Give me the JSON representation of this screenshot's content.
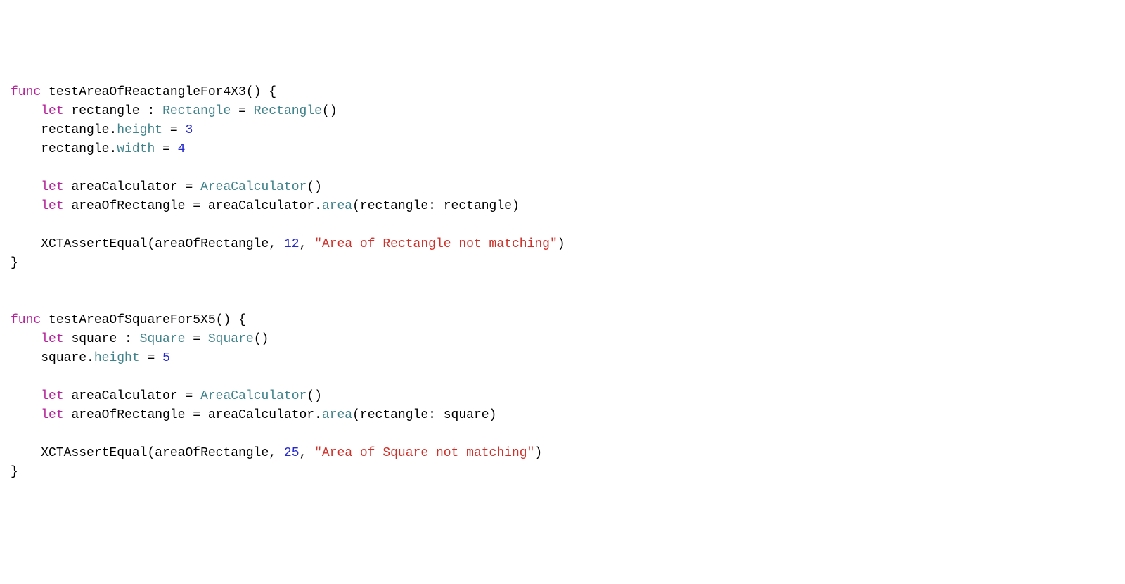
{
  "colors": {
    "keyword": "#b5219b",
    "type": "#3e828b",
    "number": "#2529cf",
    "string": "#cf2f28",
    "plain": "#000000",
    "background": "#ffffff"
  },
  "code": {
    "lines": [
      {
        "indent": 0,
        "tokens": [
          {
            "t": "func ",
            "c": "keyword"
          },
          {
            "t": "testAreaOfReactangleFor4X3() {",
            "c": "plain"
          }
        ]
      },
      {
        "indent": 1,
        "tokens": [
          {
            "t": "let ",
            "c": "keyword"
          },
          {
            "t": "rectangle : ",
            "c": "plain"
          },
          {
            "t": "Rectangle",
            "c": "type"
          },
          {
            "t": " = ",
            "c": "plain"
          },
          {
            "t": "Rectangle",
            "c": "type"
          },
          {
            "t": "()",
            "c": "plain"
          }
        ]
      },
      {
        "indent": 1,
        "tokens": [
          {
            "t": "rectangle.",
            "c": "plain"
          },
          {
            "t": "height",
            "c": "property"
          },
          {
            "t": " = ",
            "c": "plain"
          },
          {
            "t": "3",
            "c": "number"
          }
        ]
      },
      {
        "indent": 1,
        "tokens": [
          {
            "t": "rectangle.",
            "c": "plain"
          },
          {
            "t": "width",
            "c": "property"
          },
          {
            "t": " = ",
            "c": "plain"
          },
          {
            "t": "4",
            "c": "number"
          }
        ]
      },
      {
        "indent": 0,
        "tokens": [
          {
            "t": "",
            "c": "plain"
          }
        ]
      },
      {
        "indent": 1,
        "tokens": [
          {
            "t": "let ",
            "c": "keyword"
          },
          {
            "t": "areaCalculator = ",
            "c": "plain"
          },
          {
            "t": "AreaCalculator",
            "c": "type"
          },
          {
            "t": "()",
            "c": "plain"
          }
        ]
      },
      {
        "indent": 1,
        "tokens": [
          {
            "t": "let ",
            "c": "keyword"
          },
          {
            "t": "areaOfRectangle = areaCalculator.",
            "c": "plain"
          },
          {
            "t": "area",
            "c": "method"
          },
          {
            "t": "(rectangle: rectangle)",
            "c": "plain"
          }
        ]
      },
      {
        "indent": 0,
        "tokens": [
          {
            "t": "",
            "c": "plain"
          }
        ]
      },
      {
        "indent": 1,
        "tokens": [
          {
            "t": "XCTAssertEqual",
            "c": "plain"
          },
          {
            "t": "(areaOfRectangle, ",
            "c": "plain"
          },
          {
            "t": "12",
            "c": "number"
          },
          {
            "t": ", ",
            "c": "plain"
          },
          {
            "t": "\"Area of Rectangle not matching\"",
            "c": "string"
          },
          {
            "t": ")",
            "c": "plain"
          }
        ]
      },
      {
        "indent": 0,
        "tokens": [
          {
            "t": "}",
            "c": "plain"
          }
        ]
      },
      {
        "indent": 0,
        "tokens": [
          {
            "t": "",
            "c": "plain"
          }
        ]
      },
      {
        "indent": 0,
        "tokens": [
          {
            "t": "",
            "c": "plain"
          }
        ]
      },
      {
        "indent": 0,
        "tokens": [
          {
            "t": "func ",
            "c": "keyword"
          },
          {
            "t": "testAreaOfSquareFor5X5() {",
            "c": "plain"
          }
        ]
      },
      {
        "indent": 1,
        "tokens": [
          {
            "t": "let ",
            "c": "keyword"
          },
          {
            "t": "square : ",
            "c": "plain"
          },
          {
            "t": "Square",
            "c": "type"
          },
          {
            "t": " = ",
            "c": "plain"
          },
          {
            "t": "Square",
            "c": "type"
          },
          {
            "t": "()",
            "c": "plain"
          }
        ]
      },
      {
        "indent": 1,
        "tokens": [
          {
            "t": "square.",
            "c": "plain"
          },
          {
            "t": "height",
            "c": "property"
          },
          {
            "t": " = ",
            "c": "plain"
          },
          {
            "t": "5",
            "c": "number"
          }
        ]
      },
      {
        "indent": 0,
        "tokens": [
          {
            "t": "",
            "c": "plain"
          }
        ]
      },
      {
        "indent": 1,
        "tokens": [
          {
            "t": "let ",
            "c": "keyword"
          },
          {
            "t": "areaCalculator = ",
            "c": "plain"
          },
          {
            "t": "AreaCalculator",
            "c": "type"
          },
          {
            "t": "()",
            "c": "plain"
          }
        ]
      },
      {
        "indent": 1,
        "tokens": [
          {
            "t": "let ",
            "c": "keyword"
          },
          {
            "t": "areaOfRectangle = areaCalculator.",
            "c": "plain"
          },
          {
            "t": "area",
            "c": "method"
          },
          {
            "t": "(rectangle: square)",
            "c": "plain"
          }
        ]
      },
      {
        "indent": 0,
        "tokens": [
          {
            "t": "",
            "c": "plain"
          }
        ]
      },
      {
        "indent": 1,
        "tokens": [
          {
            "t": "XCTAssertEqual",
            "c": "plain"
          },
          {
            "t": "(areaOfRectangle, ",
            "c": "plain"
          },
          {
            "t": "25",
            "c": "number"
          },
          {
            "t": ", ",
            "c": "plain"
          },
          {
            "t": "\"Area of Square not matching\"",
            "c": "string"
          },
          {
            "t": ")",
            "c": "plain"
          }
        ]
      },
      {
        "indent": 0,
        "tokens": [
          {
            "t": "}",
            "c": "plain"
          }
        ]
      }
    ]
  }
}
